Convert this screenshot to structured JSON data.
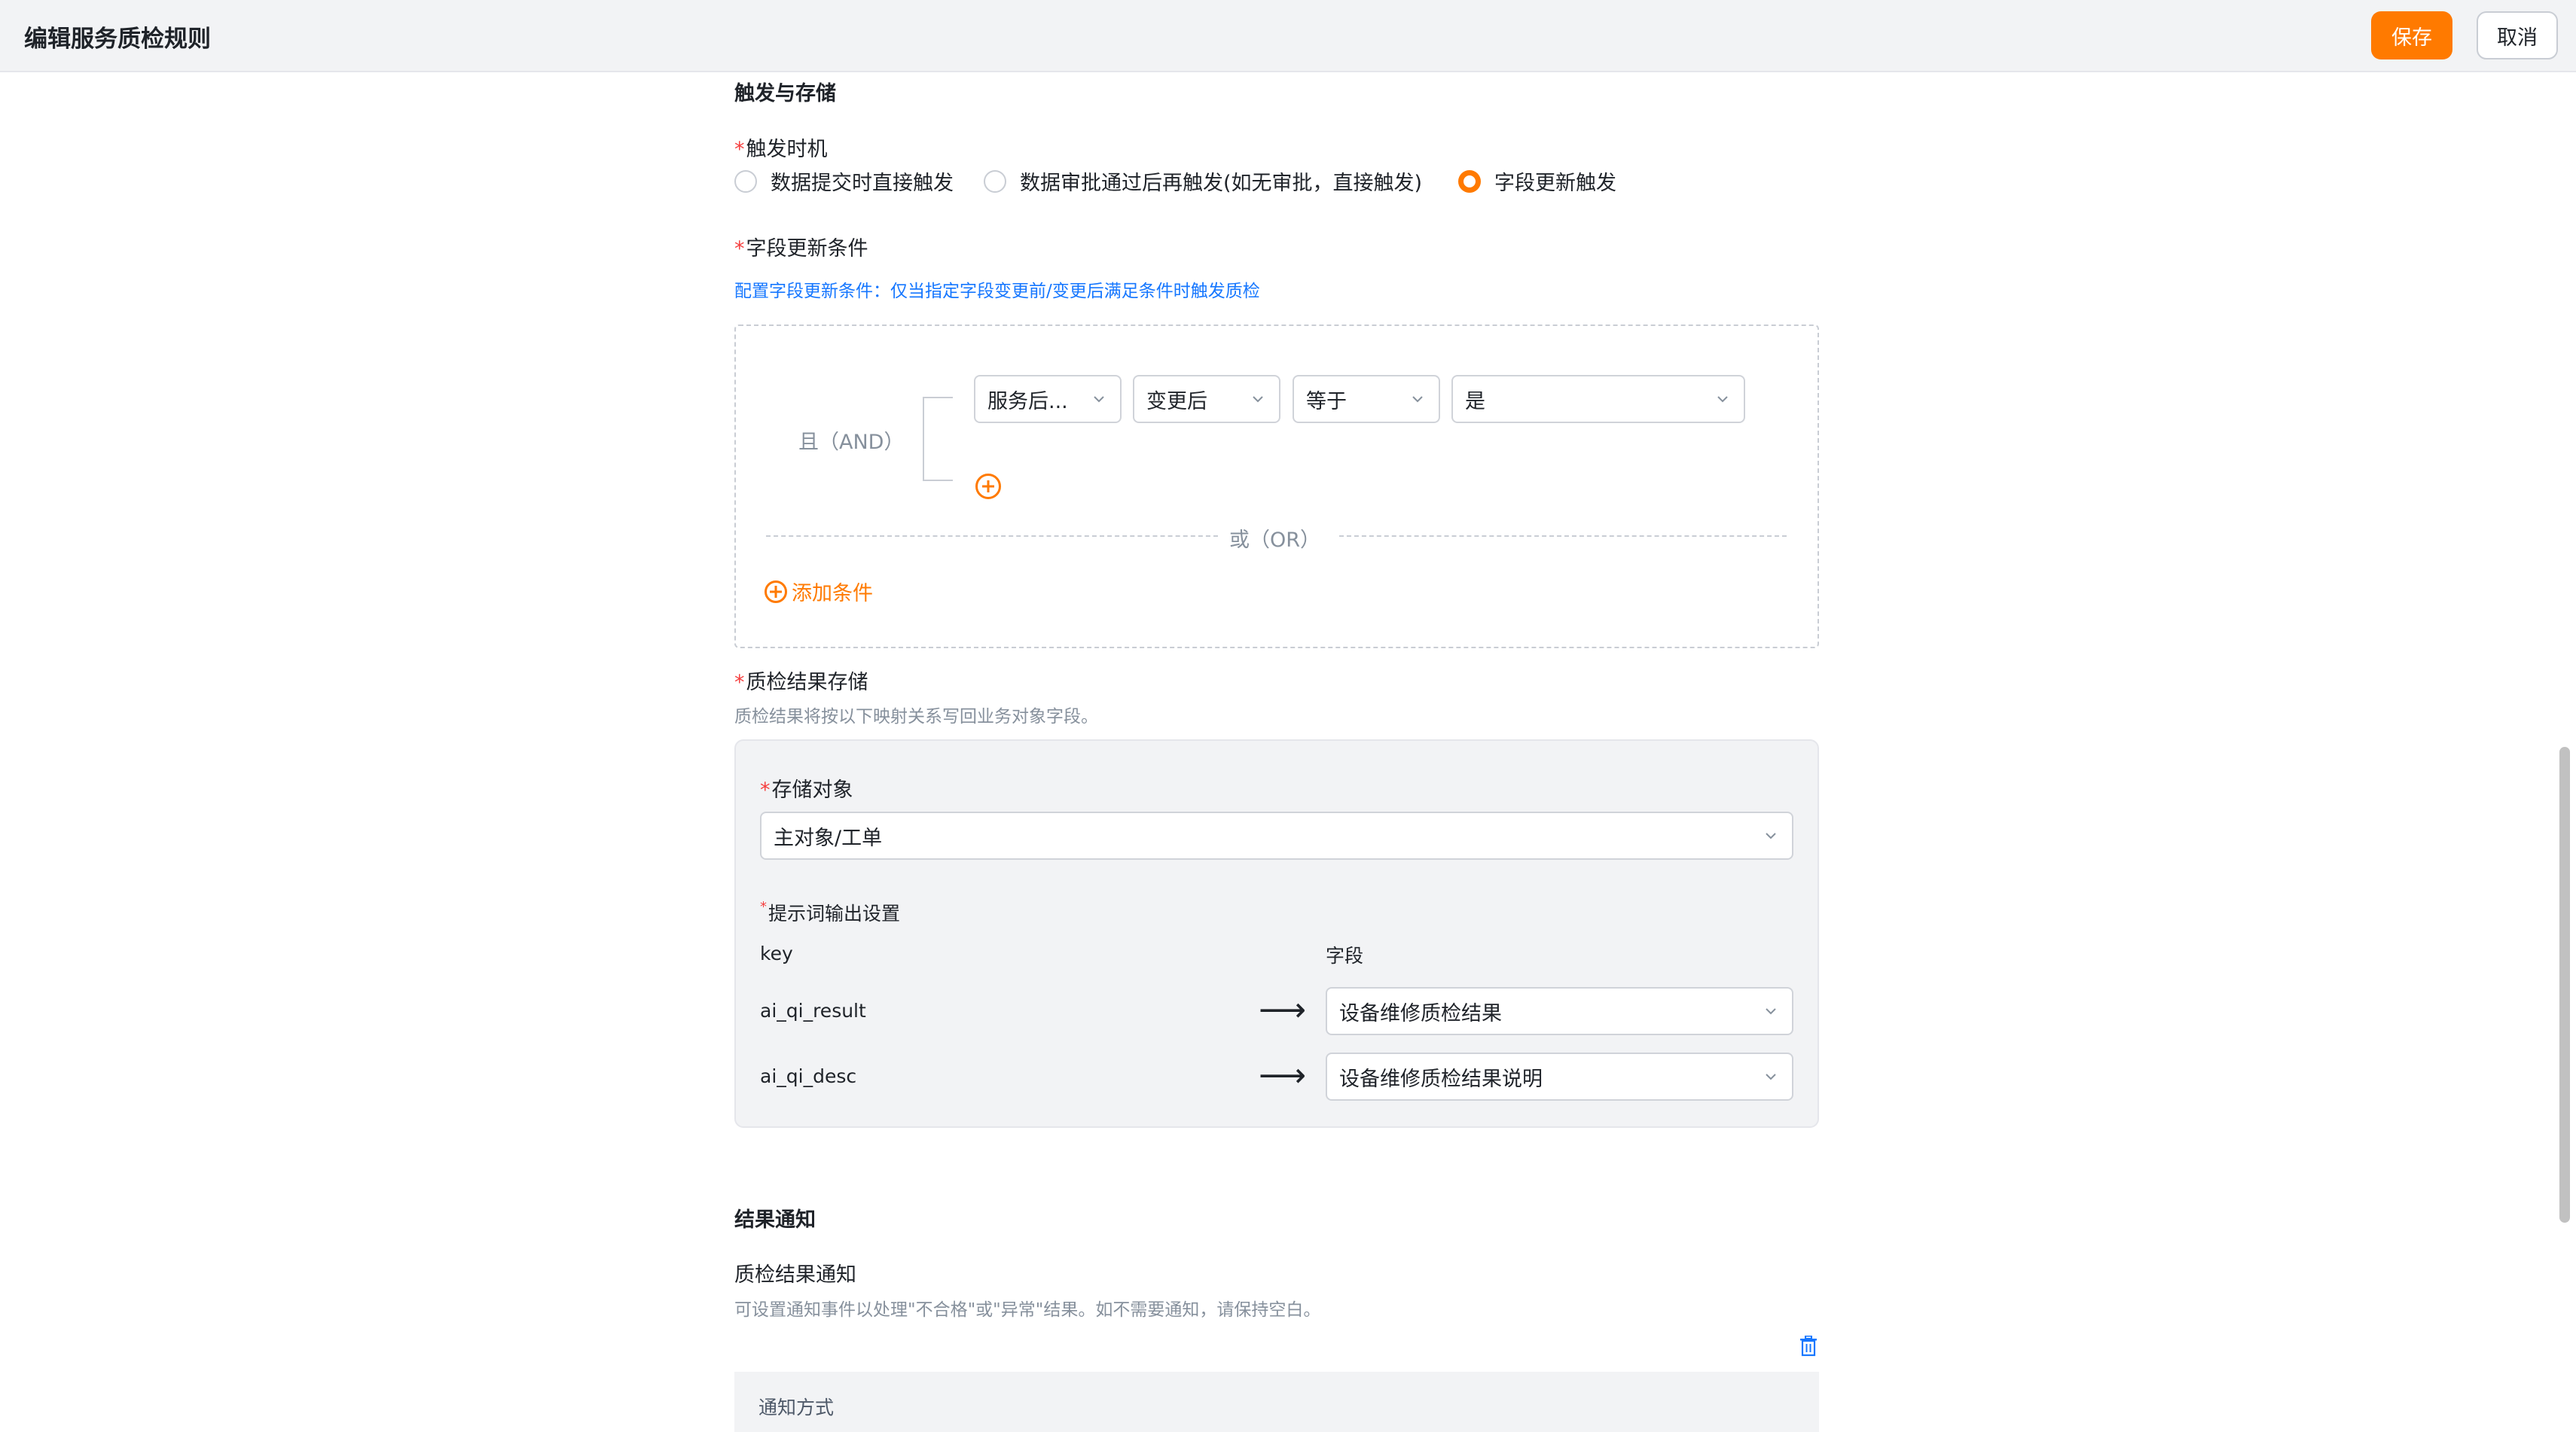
{
  "header": {
    "title": "编辑服务质检规则",
    "save_label": "保存",
    "cancel_label": "取消"
  },
  "trigger_storage": {
    "section_title": "触发与存储",
    "trigger_timing": {
      "label": "触发时机",
      "options": [
        {
          "label": "数据提交时直接触发",
          "checked": false
        },
        {
          "label": "数据审批通过后再触发(如无审批，直接触发)",
          "checked": false
        },
        {
          "label": "字段更新触发",
          "checked": true
        }
      ]
    },
    "field_update": {
      "label": "字段更新条件",
      "hint": "配置字段更新条件：仅当指定字段变更前/变更后满足条件时触发质检",
      "and_label": "且（AND）",
      "condition": {
        "field": "服务后...",
        "timing": "变更后",
        "operator": "等于",
        "value": "是"
      },
      "or_label": "或（OR）",
      "add_condition": "添加条件"
    },
    "result_storage": {
      "label": "质检结果存储",
      "hint": "质检结果将按以下映射关系写回业务对象字段。",
      "storage_object_label": "存储对象",
      "storage_object_value": "主对象/工单",
      "prompt_output_label": "提示词输出设置",
      "col_key": "key",
      "col_field": "字段",
      "mappings": [
        {
          "key": "ai_qi_result",
          "field": "设备维修质检结果"
        },
        {
          "key": "ai_qi_desc",
          "field": "设备维修质检结果说明"
        }
      ]
    }
  },
  "notification": {
    "section_title": "结果通知",
    "label": "质检结果通知",
    "hint": "可设置通知事件以处理\"不合格\"或\"异常\"结果。如不需要通知，请保持空白。",
    "method_label": "通知方式"
  },
  "colors": {
    "accent": "#ff7a00",
    "link": "#1677ff",
    "required": "#f53f3f"
  }
}
